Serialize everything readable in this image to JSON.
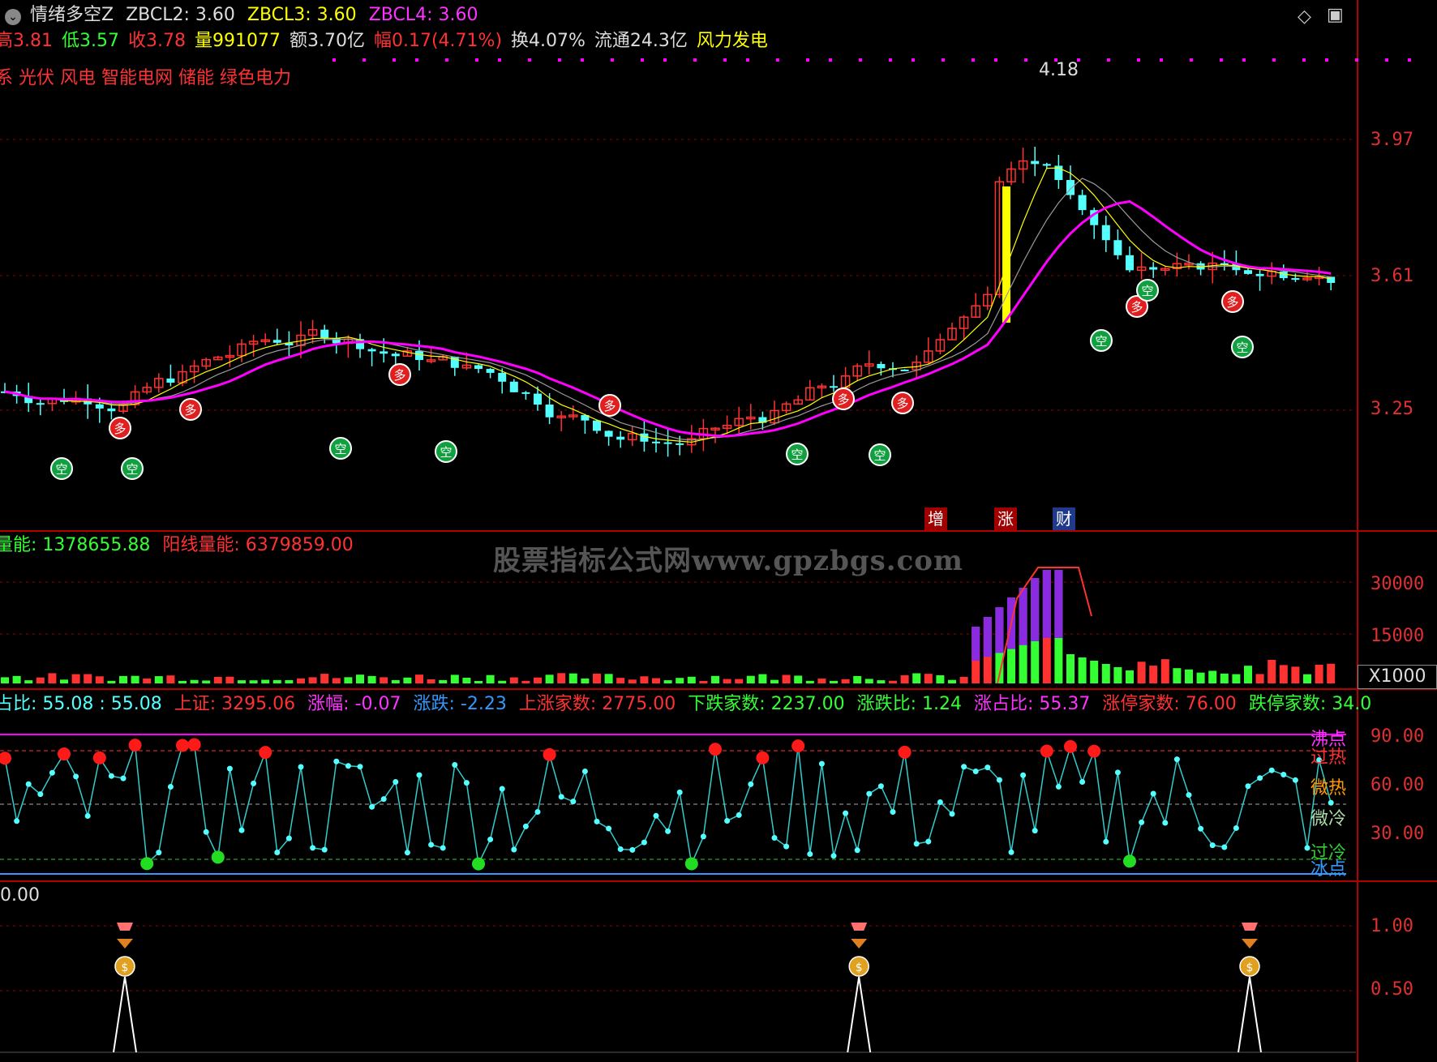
{
  "main_header": {
    "indicator_name": "情绪多空Z",
    "zbcl2": "ZBCL2: 3.60",
    "zbcl3": "ZBCL3: 3.60",
    "zbcl4": "ZBCL4: 3.60"
  },
  "quote_row": {
    "high": "高3.81",
    "low": "低3.57",
    "close": "收3.78",
    "volume": "量991077",
    "amount": "额3.70亿",
    "change": "幅0.17(4.71%)",
    "turnover": "换4.07%",
    "float": "流通24.3亿",
    "sector": "风力发电"
  },
  "concepts": "系 光伏 风电 智能电网 储能 绿色电力",
  "peak_label": "4.18",
  "price_axis": [
    "3.97",
    "3.61",
    "3.25"
  ],
  "event_tags": [
    "增",
    "涨",
    "财"
  ],
  "vol_header": {
    "label1": "量能: 1378655.88",
    "label2": "阳线量能: 6379859.00"
  },
  "watermark": "股票指标公式网www.gpzbgs.com",
  "vol_axis": [
    "30000",
    "15000"
  ],
  "vol_unit": "X1000",
  "osc_header": {
    "a": "占比: 55.08 : 55.08",
    "b": "上证: 3295.06",
    "c": "涨幅: -0.07",
    "d": "涨跌: -2.23",
    "e": "上涨家数: 2775.00",
    "f": "下跌家数: 2237.00",
    "g": "涨跌比: 1.24",
    "h": "涨占比: 55.37",
    "i": "涨停家数: 76.00",
    "j": "跌停家数: 34.0"
  },
  "osc_axis": [
    "90.00",
    "60.00",
    "30.00"
  ],
  "osc_zones": [
    "沸点",
    "过热",
    "微热",
    "微冷",
    "过冷",
    "冰点"
  ],
  "sig_header": "0.00",
  "sig_axis": [
    "1.00",
    "0.50"
  ],
  "signals_bar_index": [
    10,
    72,
    105
  ],
  "colors": {
    "up": "#ff3232",
    "down": "#54ffff",
    "ma": "#ff00ff",
    "grid": "#8a0000",
    "axis": "#e03030"
  }
}
